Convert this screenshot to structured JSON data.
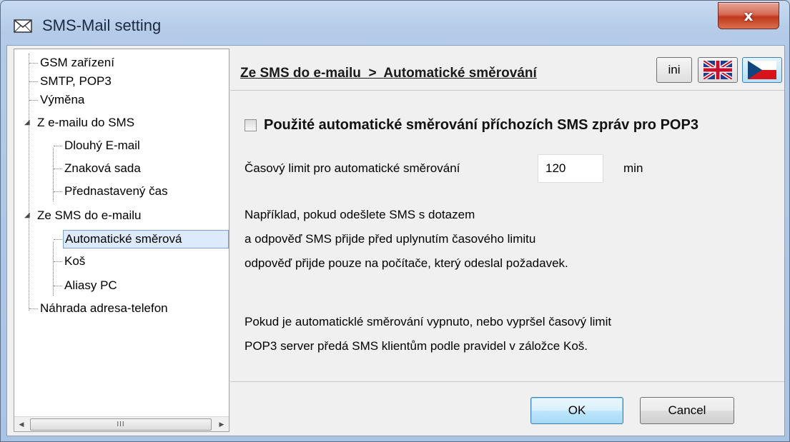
{
  "window": {
    "title": "SMS-Mail setting",
    "close_glyph": "x"
  },
  "tree": {
    "items": [
      {
        "label": "GSM zařízení"
      },
      {
        "label": "SMTP, POP3"
      },
      {
        "label": "Výměna"
      },
      {
        "label": "Z e-mailu do SMS",
        "expanded": true
      },
      {
        "label": "Dlouhý E-mail"
      },
      {
        "label": "Znaková sada"
      },
      {
        "label": "Přednastavený čas"
      },
      {
        "label": "Ze SMS do e-mailu",
        "expanded": true
      },
      {
        "label": "Automatické směrová",
        "selected": true
      },
      {
        "label": "Koš"
      },
      {
        "label": "Aliasy PC"
      },
      {
        "label": "Náhrada adresa-telefon"
      }
    ],
    "scroll_thumb_grip": "III"
  },
  "header": {
    "breadcrumb": "Ze SMS do e-mailu  >  Automatické směrování",
    "ini_label": "ini",
    "flag_uk_icon": "uk-flag-icon",
    "flag_cz_icon": "cz-flag-icon"
  },
  "content": {
    "checkbox_label": "Použité automatické směrování příchozích SMS zpráv pro POP3",
    "checkbox_checked": false,
    "time_label": "Časový limit pro automatické směrování",
    "time_value": "120",
    "time_unit": "min",
    "para1": [
      "Například, pokud odešlete SMS s dotazem",
      "a odpověď SMS přijde před uplynutím časového limitu",
      "odpověď přijde pouze na počítače, který odeslal požadavek."
    ],
    "para2": [
      "Pokud je automaticklé směrování vypnuto, nebo vypršel časový limit",
      "POP3 server předá SMS klientům podle pravidel v záložce Koš."
    ]
  },
  "buttons": {
    "ok": "OK",
    "cancel": "Cancel"
  }
}
